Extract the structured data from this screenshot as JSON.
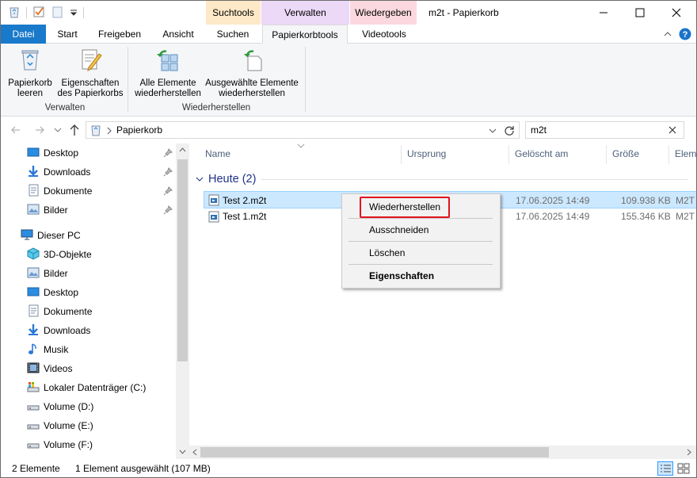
{
  "titlebar": {
    "title": "m2t - Papierkorb",
    "context_groups": [
      {
        "header": "Suchtools",
        "color": "#fde9c7"
      },
      {
        "header": "Verwalten",
        "color": "#ecd8f7"
      },
      {
        "header": "Wiedergeben",
        "color": "#fbd8e0"
      }
    ]
  },
  "tabs": {
    "file": "Datei",
    "start": "Start",
    "share": "Freigeben",
    "view": "Ansicht",
    "search": "Suchen",
    "recycle_tools": "Papierkorbtools",
    "video_tools": "Videotools"
  },
  "ribbon": {
    "empty_bin": [
      "Papierkorb",
      "leeren"
    ],
    "bin_properties": [
      "Eigenschaften",
      "des Papierkorbs"
    ],
    "group_manage": "Verwalten",
    "restore_all": [
      "Alle Elemente",
      "wiederherstellen"
    ],
    "restore_selected": [
      "Ausgewählte Elemente",
      "wiederherstellen"
    ],
    "group_restore": "Wiederherstellen"
  },
  "address": {
    "path": "Papierkorb",
    "search_value": "m2t"
  },
  "nav": {
    "quick_access": [
      {
        "label": "Desktop",
        "icon": "desktop-icon"
      },
      {
        "label": "Downloads",
        "icon": "downloads-icon"
      },
      {
        "label": "Dokumente",
        "icon": "documents-icon"
      },
      {
        "label": "Bilder",
        "icon": "pictures-icon"
      }
    ],
    "this_pc": "Dieser PC",
    "pc_items": [
      {
        "label": "3D-Objekte",
        "icon": "3d-objects-icon"
      },
      {
        "label": "Bilder",
        "icon": "pictures-icon"
      },
      {
        "label": "Desktop",
        "icon": "desktop-icon"
      },
      {
        "label": "Dokumente",
        "icon": "documents-icon"
      },
      {
        "label": "Downloads",
        "icon": "downloads-icon"
      },
      {
        "label": "Musik",
        "icon": "music-icon"
      },
      {
        "label": "Videos",
        "icon": "videos-icon"
      },
      {
        "label": "Lokaler Datenträger (C:)",
        "icon": "system-drive-icon"
      },
      {
        "label": "Volume (D:)",
        "icon": "drive-icon"
      },
      {
        "label": "Volume (E:)",
        "icon": "drive-icon"
      },
      {
        "label": "Volume (F:)",
        "icon": "drive-icon"
      }
    ]
  },
  "columns": {
    "name": "Name",
    "origin": "Ursprung",
    "deleted": "Gelöscht am",
    "size": "Größe",
    "type": "Elem"
  },
  "group": {
    "title": "Heute (2)"
  },
  "files": [
    {
      "name": "Test 2.m2t",
      "deleted": "17.06.2025 14:49",
      "size": "109.938 KB",
      "type": "M2T",
      "selected": true
    },
    {
      "name": "Test 1.m2t",
      "deleted": "17.06.2025 14:49",
      "size": "155.346 KB",
      "type": "M2T",
      "selected": false
    }
  ],
  "context_menu": {
    "restore": "Wiederherstellen",
    "cut": "Ausschneiden",
    "delete": "Löschen",
    "properties": "Eigenschaften"
  },
  "status": {
    "count": "2 Elemente",
    "selection": "1 Element ausgewählt (107 MB)"
  },
  "colors": {
    "accent": "#1979ca",
    "selection": "#cce8ff",
    "highlight_box": "#e0141e"
  }
}
